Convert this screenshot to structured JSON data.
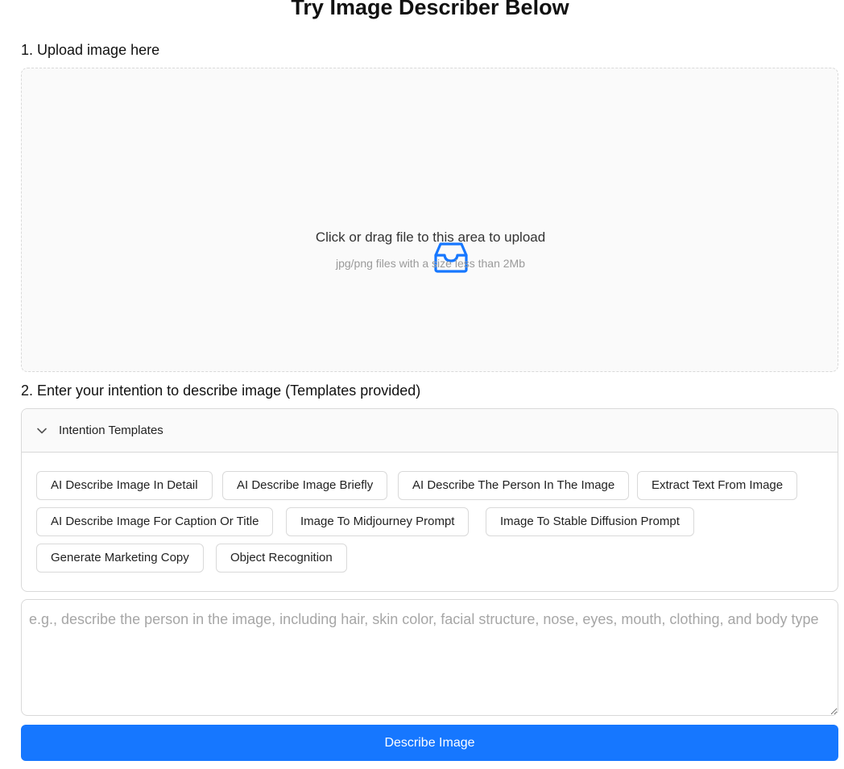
{
  "page": {
    "title": "Try Image Describer Below"
  },
  "upload": {
    "step_label": "1. Upload image here",
    "drop_text": "Click or drag file to this area to upload",
    "drop_hint": "jpg/png files with a size less than 2Mb",
    "icon": "inbox-icon",
    "accent_color": "#1677ff"
  },
  "intention": {
    "step_label": "2. Enter your intention to describe image (Templates provided)",
    "templates_header": "Intention Templates",
    "templates_expanded": true,
    "templates": [
      "AI Describe Image In Detail",
      "AI Describe Image Briefly",
      "AI Describe The Person In The Image",
      "Extract Text From Image",
      "AI Describe Image For Caption Or Title",
      "Image To Midjourney Prompt",
      "Image To Stable Diffusion Prompt",
      "Generate Marketing Copy",
      "Object Recognition"
    ],
    "input_value": "",
    "input_placeholder": "e.g., describe the person in the image, including hair, skin color, facial structure, nose, eyes, mouth, clothing, and body type"
  },
  "actions": {
    "submit_label": "Describe Image",
    "primary_color": "#1677ff"
  }
}
